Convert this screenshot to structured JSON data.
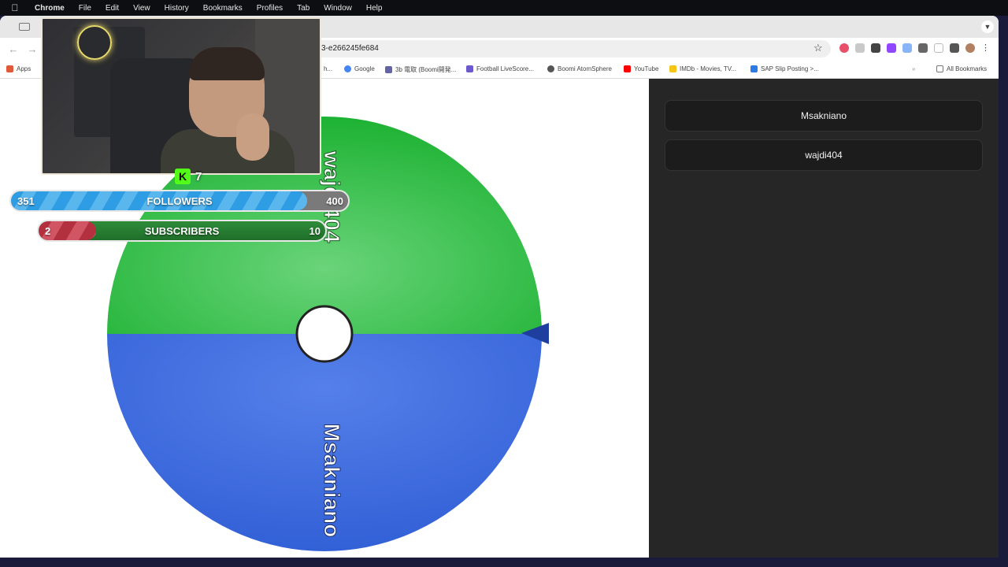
{
  "menubar": {
    "app_name": "Chrome",
    "items": [
      "File",
      "Edit",
      "View",
      "History",
      "Bookmarks",
      "Profiles",
      "Tab",
      "Window",
      "Help"
    ]
  },
  "browser": {
    "url_fragment": "3-e266245fe684",
    "bookmarks": [
      {
        "label": "Apps",
        "icon": "apps-grid-icon",
        "color": "#e05a3a"
      },
      {
        "label": "h...",
        "icon": "bookmark-icon",
        "color": "#999999"
      },
      {
        "label": "Google",
        "icon": "google-icon",
        "color": "#4285f4"
      },
      {
        "label": "3b 電取 (Boomi開発...",
        "icon": "teams-icon",
        "color": "#6264a7"
      },
      {
        "label": "Football LiveScore...",
        "icon": "football-icon",
        "color": "#6a5acd"
      },
      {
        "label": "Boomi AtomSphere",
        "icon": "boomi-icon",
        "color": "#555555"
      },
      {
        "label": "YouTube",
        "icon": "youtube-icon",
        "color": "#ff0000"
      },
      {
        "label": "IMDb - Movies, TV...",
        "icon": "imdb-icon",
        "color": "#f5c518"
      },
      {
        "label": "SAP Slip Posting >...",
        "icon": "sap-icon",
        "color": "#2c7be5"
      }
    ],
    "all_bookmarks": "All Bookmarks"
  },
  "wheel": {
    "segments": [
      {
        "label": "wajdi404",
        "color": "#1fb535"
      },
      {
        "label": "Msakniano",
        "color": "#3d6fe0"
      }
    ],
    "pointer_color": "#1e3f9e"
  },
  "names": [
    "Msakniano",
    "wajdi404"
  ],
  "overlay": {
    "kick_viewers": "7",
    "followers": {
      "current": "351",
      "label": "FOLLOWERS",
      "goal": "400",
      "progress": 0.8775
    },
    "subscribers": {
      "current": "2",
      "label": "SUBSCRIBERS",
      "goal": "10",
      "progress": 0.2
    }
  }
}
